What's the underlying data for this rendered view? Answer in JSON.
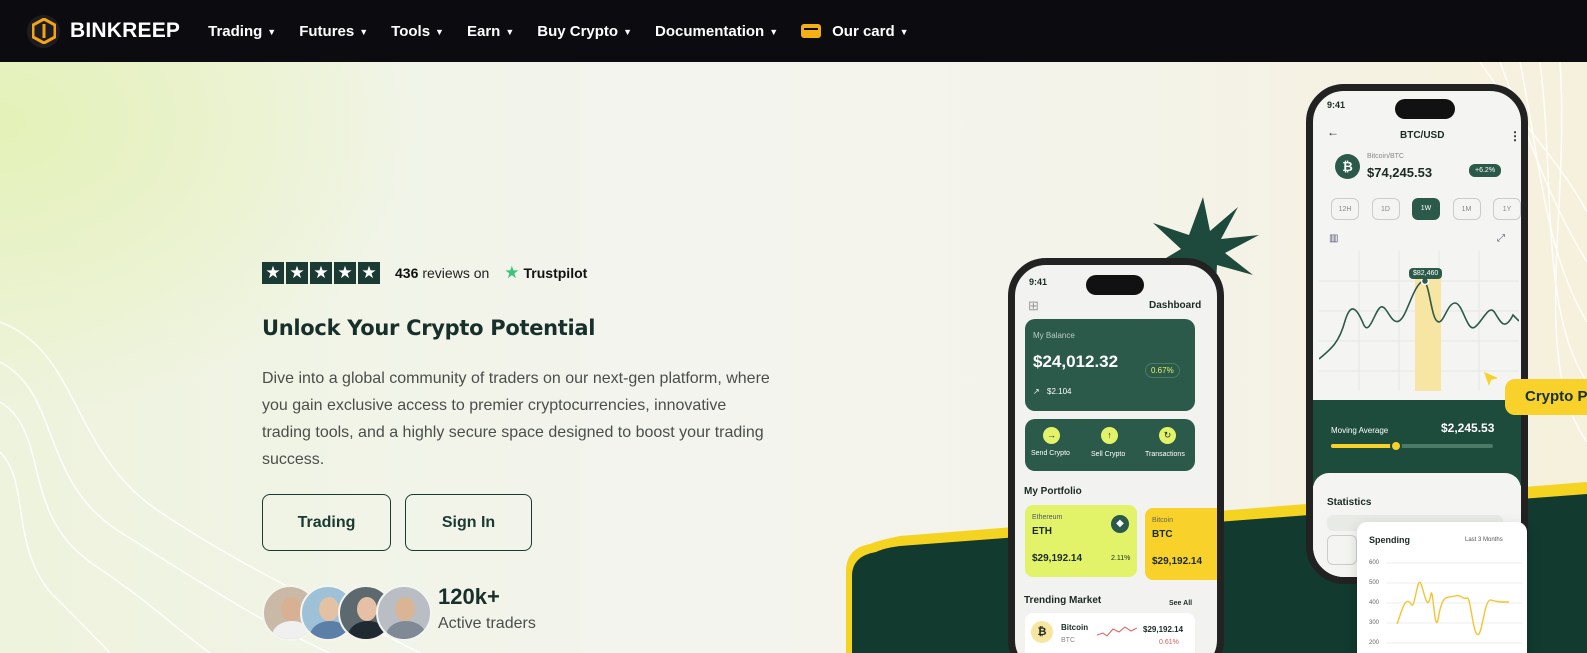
{
  "nav": {
    "brand": "BINKREEP",
    "items": [
      {
        "label": "Trading"
      },
      {
        "label": "Futures"
      },
      {
        "label": "Tools"
      },
      {
        "label": "Earn"
      },
      {
        "label": "Buy Crypto"
      },
      {
        "label": "Documentation"
      },
      {
        "label": "Our card"
      }
    ]
  },
  "hero": {
    "rating": {
      "count": "436",
      "text": "reviews on",
      "brand": "Trustpilot",
      "stars": 5
    },
    "title": "Unlock Your Crypto Potential",
    "description": "Dive into a global community of traders on our next-gen platform, where you gain exclusive access to premier cryptocurrencies, innovative trading tools, and a highly secure space designed to boost your trading success.",
    "buttons": {
      "trading": "Trading",
      "signin": "Sign In"
    },
    "traders": {
      "count": "120k+",
      "label": "Active traders"
    }
  },
  "phone_dashboard": {
    "time": "9:41",
    "title": "Dashboard",
    "balance_label": "My Balance",
    "balance": "$24,012.32",
    "change": "0.67%",
    "gain": "$2.104",
    "actions": [
      "Send Crypto",
      "Sell Crypto",
      "Transactions"
    ],
    "portfolio_title": "My Portfolio",
    "portfolio": [
      {
        "name": "Ethereum",
        "symbol": "ETH",
        "price": "$29,192.14",
        "change": "2.11%"
      },
      {
        "name": "Bitcoin",
        "symbol": "BTC",
        "price": "$29,192.14"
      }
    ],
    "trending_title": "Trending Market",
    "see_all": "See All",
    "trending": [
      {
        "name": "Bitcoin",
        "symbol": "BTC",
        "price": "$29,192.14",
        "change": "0.61%"
      }
    ]
  },
  "phone_chart": {
    "time": "9:41",
    "pair": "BTC/USD",
    "coin": "Bitcoin/BTC",
    "price": "$74,245.53",
    "change": "+6.2%",
    "ranges": [
      "12H",
      "1D",
      "1W",
      "1M",
      "1Y"
    ],
    "active_range": "1W",
    "tooltip": "$82,460",
    "ma_label": "Moving Average",
    "ma_value": "$2,245.53",
    "ma_level": 0.4,
    "statistics": "Statistics"
  },
  "badge": {
    "label": "Crypto P"
  },
  "spending": {
    "title": "Spending",
    "period": "Last 3 Months",
    "y_ticks": [
      "600",
      "500",
      "400",
      "300",
      "200"
    ]
  },
  "colors": {
    "dark_green": "#1a3a33",
    "lime": "#e2f36a",
    "yellow": "#f8d12a",
    "nav_bg": "#0b0b10"
  }
}
